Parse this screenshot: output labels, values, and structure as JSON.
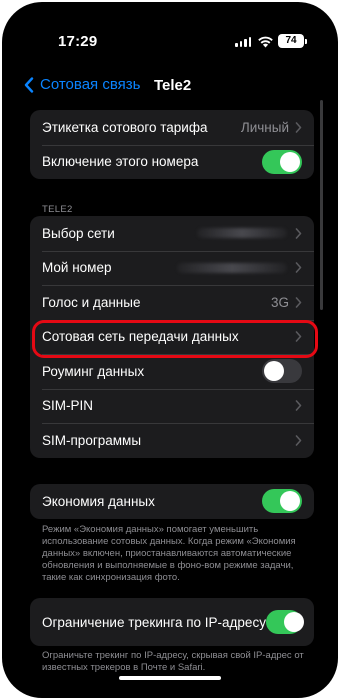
{
  "status_bar": {
    "time": "17:29",
    "battery": "74",
    "icons": [
      "cellular-signal-icon",
      "wifi-icon",
      "battery-icon"
    ]
  },
  "nav": {
    "back_label": "Сотовая связь",
    "title": "Tele2"
  },
  "group1": {
    "rows": [
      {
        "label": "Этикетка сотового тарифа",
        "value": "Личный",
        "accessory": "chevron"
      },
      {
        "label": "Включение этого номера",
        "toggle": true
      }
    ]
  },
  "section": {
    "header": "TELE2"
  },
  "group2": {
    "rows": [
      {
        "label": "Выбор сети",
        "accessory": "chevron",
        "value_redacted": true
      },
      {
        "label": "Мой номер",
        "accessory": "chevron",
        "value_redacted": true
      },
      {
        "label": "Голос и данные",
        "value": "3G",
        "accessory": "chevron"
      },
      {
        "label": "Сотовая сеть передачи данных",
        "accessory": "chevron",
        "highlighted": true
      },
      {
        "label": "Роуминг данных",
        "toggle": false
      },
      {
        "label": "SIM-PIN",
        "accessory": "chevron"
      },
      {
        "label": "SIM-программы",
        "accessory": "chevron"
      }
    ]
  },
  "group3": {
    "rows": [
      {
        "label": "Экономия данных",
        "toggle": true
      }
    ],
    "footnote": "Режим «Экономия данных» помогает уменьшить использование сотовых данных. Когда режим «Экономия данных» включен, приостанавливаются автоматические обновления и выполняемые в фоно-вом режиме задачи, такие как синхронизация фото."
  },
  "group4": {
    "rows": [
      {
        "label": "Ограничение трекинга по IP-адресу",
        "toggle": true
      }
    ],
    "footnote": "Ограничьте трекинг по IP-адресу, скрывая свой IP-адрес от известных трекеров в Почте и Safari."
  },
  "colors": {
    "accent": "#0a84ff",
    "toggle_on": "#34c759",
    "highlight_border": "#e50914",
    "cell_background": "#1c1c1e",
    "secondary_text": "#8e8e93"
  }
}
